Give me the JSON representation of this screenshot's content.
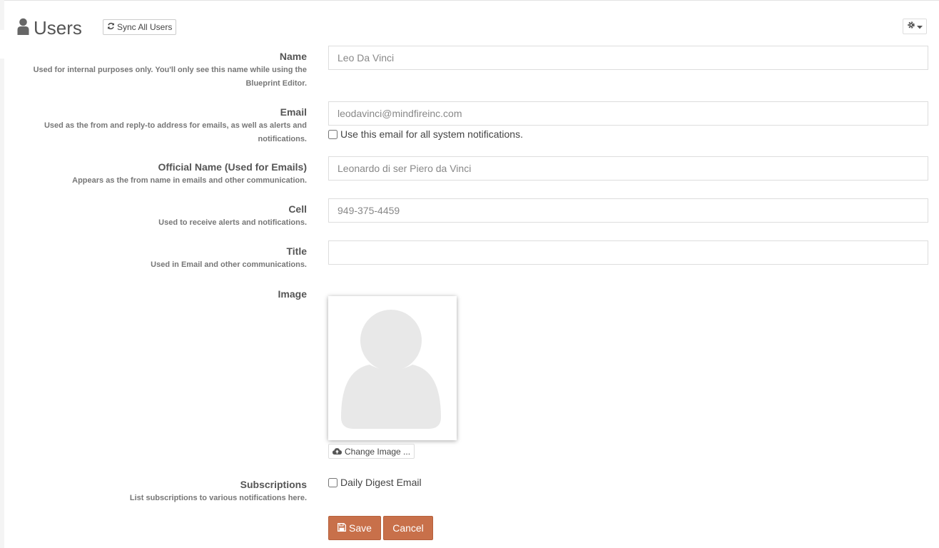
{
  "header": {
    "title": "Users",
    "sync_label": "Sync All Users"
  },
  "form": {
    "name": {
      "label": "Name",
      "help_line1": "Used for internal purposes only. You'll only see this name while using the",
      "help_line2": "Blueprint Editor.",
      "value": "Leo Da Vinci"
    },
    "email": {
      "label": "Email",
      "help_line1": "Used as the from and reply-to address for emails, as well as alerts and",
      "help_line2": "notifications.",
      "value": "leodavinci@mindfireinc.com",
      "checkbox_label": "Use this email for all system notifications."
    },
    "official_name": {
      "label": "Official Name (Used for Emails)",
      "help": "Appears as the from name in emails and other communication.",
      "value": "Leonardo di ser Piero da Vinci"
    },
    "cell": {
      "label": "Cell",
      "help": "Used to receive alerts and notifications.",
      "value": "949-375-4459"
    },
    "title_field": {
      "label": "Title",
      "help": "Used in Email and other communications.",
      "value": ""
    },
    "image": {
      "label": "Image",
      "change_label": "Change Image ..."
    },
    "subscriptions": {
      "label": "Subscriptions",
      "help": "List subscriptions to various notifications here.",
      "option_label": "Daily Digest Email"
    }
  },
  "actions": {
    "save_label": "Save",
    "cancel_label": "Cancel"
  },
  "colors": {
    "accent": "#c8704a",
    "icon": "#666666"
  }
}
